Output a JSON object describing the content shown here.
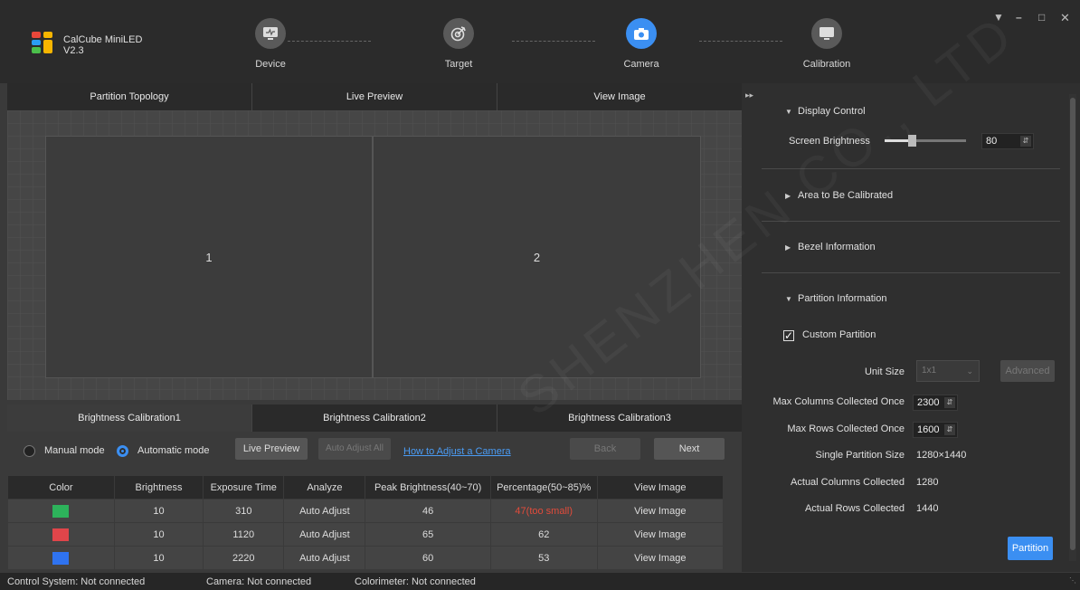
{
  "app": {
    "name": "CalCube MiniLED",
    "version": "V2.3"
  },
  "steps": [
    {
      "label": "Device",
      "icon": "monitor-wave-icon"
    },
    {
      "label": "Target",
      "icon": "target-icon"
    },
    {
      "label": "Camera",
      "icon": "camera-icon"
    },
    {
      "label": "Calibration",
      "icon": "screen-icon"
    }
  ],
  "active_step": "Camera",
  "view_tabs": [
    "Partition Topology",
    "Live Preview",
    "View Image"
  ],
  "partitions": [
    "1",
    "2"
  ],
  "calib_tabs": [
    "Brightness Calibration1",
    "Brightness Calibration2",
    "Brightness Calibration3"
  ],
  "modes": {
    "manual": "Manual mode",
    "automatic": "Automatic mode"
  },
  "buttons": {
    "live_preview": "Live Preview",
    "auto_adjust_all": "Auto Adjust All",
    "how_to": "How to Adjust a Camera",
    "back": "Back",
    "next": "Next",
    "advanced": "Advanced",
    "partition": "Partition"
  },
  "table": {
    "headers": [
      "Color",
      "Brightness",
      "Exposure Time",
      "Analyze",
      "Peak Brightness(40~70)",
      "Percentage(50~85)%",
      "View Image"
    ],
    "rows": [
      {
        "color": "#2db35b",
        "brightness": "10",
        "exposure": "310",
        "analyze": "Auto Adjust",
        "peak": "46",
        "percentage": "47(too small)",
        "view": "View Image"
      },
      {
        "color": "#e0454a",
        "brightness": "10",
        "exposure": "1120",
        "analyze": "Auto Adjust",
        "peak": "65",
        "percentage": "62",
        "view": "View Image"
      },
      {
        "color": "#2f73f0",
        "brightness": "10",
        "exposure": "2220",
        "analyze": "Auto Adjust",
        "peak": "60",
        "percentage": "53",
        "view": "View Image"
      }
    ]
  },
  "right": {
    "display_control": "Display Control",
    "screen_brightness_label": "Screen Brightness",
    "screen_brightness_value": "80",
    "screen_brightness_fraction": 0.33,
    "area": "Area to Be Calibrated",
    "bezel": "Bezel Information",
    "partition_info": "Partition Information",
    "custom_partition": "Custom Partition",
    "unit_size_label": "Unit Size",
    "unit_size_value": "1x1",
    "max_cols_label": "Max Columns Collected Once",
    "max_cols_value": "2300",
    "max_rows_label": "Max Rows Collected Once",
    "max_rows_value": "1600",
    "single_size_label": "Single Partition Size",
    "single_size_value": "1280×1440",
    "actual_cols_label": "Actual Columns Collected",
    "actual_cols_value": "1280",
    "actual_rows_label": "Actual Rows Collected",
    "actual_rows_value": "1440"
  },
  "watermark": "SHENZHEN CO., LTD",
  "status": {
    "control": "Control System: Not connected",
    "camera": "Camera: Not connected",
    "colorimeter": "Colorimeter: Not connected"
  },
  "colors": {
    "accent": "#3b8ff2",
    "warning": "#e24b3b"
  }
}
